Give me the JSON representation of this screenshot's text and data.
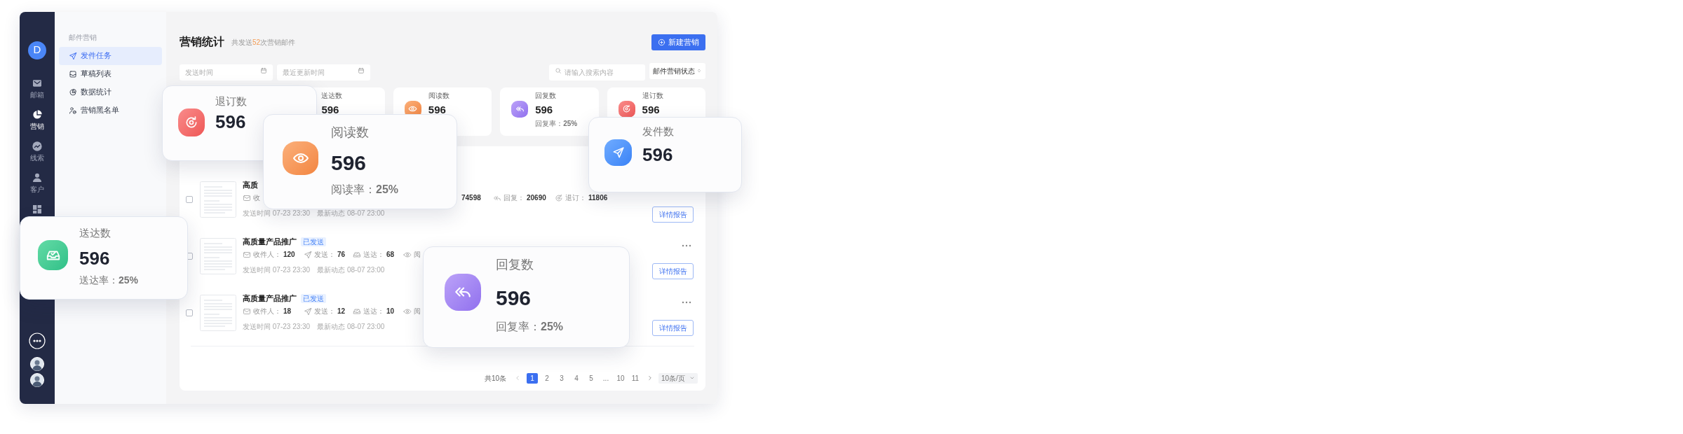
{
  "rail": {
    "avatar": "D",
    "items": [
      {
        "kind": "mail",
        "label": "邮箱",
        "selected": false
      },
      {
        "kind": "pie",
        "label": "营销",
        "selected": true
      },
      {
        "kind": "trend",
        "label": "线索",
        "selected": false
      },
      {
        "kind": "person",
        "label": "客户",
        "selected": false
      },
      {
        "kind": "dashboard",
        "selected": false
      }
    ]
  },
  "sidebar": {
    "section": "邮件营销",
    "items": [
      {
        "kind": "send",
        "label": "发件任务",
        "selected": true
      },
      {
        "kind": "draft",
        "label": "草稿列表",
        "selected": false
      },
      {
        "kind": "stats",
        "label": "数据统计",
        "selected": false
      },
      {
        "kind": "blacklist",
        "label": "营销黑名单",
        "selected": false
      }
    ]
  },
  "header": {
    "title": "营销统计",
    "summary": {
      "prefix": "共发送",
      "count": "52",
      "suffix": "次营销邮件"
    },
    "new_button": "新建营销"
  },
  "filters": {
    "date_fields": [
      {
        "placeholder": "发送时间"
      },
      {
        "placeholder": "最近更新时间"
      }
    ],
    "search": {
      "placeholder": "请输入搜索内容"
    },
    "status_select": "邮件营销状态"
  },
  "stat_cards": [
    {
      "kind": "delivered",
      "label": "送达数",
      "value": "596",
      "icon": false
    },
    {
      "kind": "read",
      "label": "阅读数",
      "value": "596"
    },
    {
      "kind": "reply",
      "label": "回复数",
      "value": "596",
      "rate": "回复率：**25%**"
    },
    {
      "kind": "unsubscribe",
      "label": "退订数",
      "value": "596"
    }
  ],
  "tasks": [
    {
      "title": "高质",
      "checked": false,
      "menu": false,
      "stats": [
        {
          "kind": "recipients",
          "label": "收"
        },
        {
          "kind": "read",
          "value": "74598",
          "icon": false
        },
        {
          "kind": "reply",
          "label": "回复：",
          "value": "20690"
        },
        {
          "kind": "unsubscribe",
          "label": "退订：",
          "value": "11806"
        }
      ],
      "times": [
        "发送时间 07-23 23:30",
        "最新动态 08-07 23:00"
      ],
      "button": "详情报告"
    },
    {
      "title": "高质量产品推广",
      "tag": "已发送",
      "checked": false,
      "menu": true,
      "stats": [
        {
          "kind": "recipients",
          "label": "收件人：",
          "value": "120"
        },
        {
          "kind": "sent",
          "label": "发送：",
          "value": "76"
        },
        {
          "kind": "delivered",
          "label": "送达：",
          "value": "68"
        },
        {
          "kind": "read",
          "label": "阅"
        }
      ],
      "times": [
        "发送时间 07-23 23:30",
        "最新动态 08-07 23:00"
      ],
      "button": "详情报告"
    },
    {
      "title": "高质量产品推广",
      "tag": "已发送",
      "checked": false,
      "menu": true,
      "stats": [
        {
          "kind": "recipients",
          "label": "收件人：",
          "value": "18"
        },
        {
          "kind": "sent",
          "label": "发送：",
          "value": "12"
        },
        {
          "kind": "delivered",
          "label": "送达：",
          "value": "10"
        },
        {
          "kind": "read",
          "label": "阅"
        }
      ],
      "times": [
        "发送时间 07-23 23:30",
        "最新动态 08-07 23:00"
      ],
      "button": "详情报告"
    }
  ],
  "pagination": {
    "total": "共10条",
    "pages": [
      {
        "label": "1",
        "selected": true
      },
      {
        "label": "2",
        "selected": false
      },
      {
        "label": "3",
        "selected": false
      },
      {
        "label": "4",
        "selected": false
      },
      {
        "label": "5",
        "selected": false
      },
      {
        "label": "...",
        "selected": false
      },
      {
        "label": "10",
        "selected": false
      },
      {
        "label": "11",
        "selected": false
      }
    ],
    "page_size": "10条/页"
  },
  "highlights": [
    {
      "kind": "unsubscribe",
      "label": "退订数",
      "value": "596"
    },
    {
      "kind": "read",
      "label": "阅读数",
      "value": "596",
      "rate": "阅读率：**25%**"
    },
    {
      "kind": "sent",
      "label": "发件数",
      "value": "596"
    },
    {
      "kind": "delivered",
      "label": "送达数",
      "value": "596",
      "rate": "送达率：**25%**"
    },
    {
      "kind": "reply",
      "label": "回复数",
      "value": "596",
      "rate": "回复率：**25%**"
    }
  ]
}
